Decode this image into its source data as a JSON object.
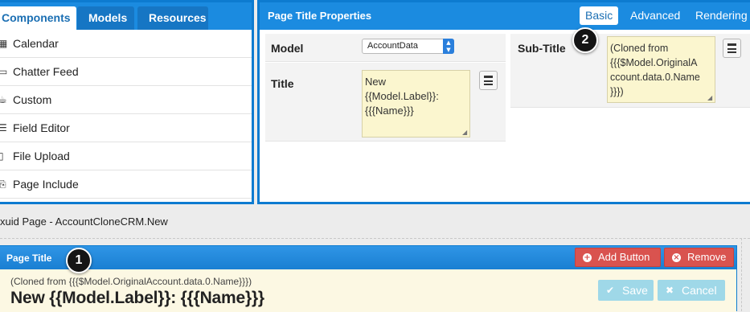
{
  "left_panel": {
    "tabs": [
      {
        "label": "Components",
        "active": true
      },
      {
        "label": "Models",
        "active": false
      },
      {
        "label": "Resources",
        "active": false
      }
    ],
    "components": [
      {
        "label": "Calendar",
        "icon": "calendar-icon"
      },
      {
        "label": "Chatter Feed",
        "icon": "chat-bubble-icon"
      },
      {
        "label": "Custom",
        "icon": "coffee-icon"
      },
      {
        "label": "Field Editor",
        "icon": "list-icon"
      },
      {
        "label": "File Upload",
        "icon": "file-icon"
      },
      {
        "label": "Page Include",
        "icon": "page-include-icon"
      }
    ]
  },
  "properties": {
    "title": "Page Title Properties",
    "tabs": [
      {
        "label": "Basic",
        "active": true
      },
      {
        "label": "Advanced",
        "active": false
      },
      {
        "label": "Rendering",
        "active": false
      }
    ],
    "model_label": "Model",
    "model_value": "AccountData",
    "title_label": "Title",
    "title_value": "New\n{{Model.Label}}:\n{{{Name}}}",
    "subtitle_label": "Sub-Title",
    "subtitle_value": "(Cloned from\n{{{$Model.OriginalA\nccount.data.0.Name\n}}})"
  },
  "callouts": {
    "one": "1",
    "two": "2"
  },
  "page": {
    "label": "xuid Page - AccountCloneCRM.New",
    "component_title": "Page Title",
    "add_button": "Add Button",
    "remove_button": "Remove",
    "preview_subtitle": "(Cloned from {{{$Model.OriginalAccount.data.0.Name}}})",
    "preview_title": "New {{Model.Label}}: {{{Name}}}",
    "save_button": "Save",
    "cancel_button": "Cancel"
  },
  "colors": {
    "accent": "#1b8be0",
    "danger": "#d9534f",
    "preview_bg": "#fcf8e3",
    "textarea_bg": "#fbf6cf"
  }
}
